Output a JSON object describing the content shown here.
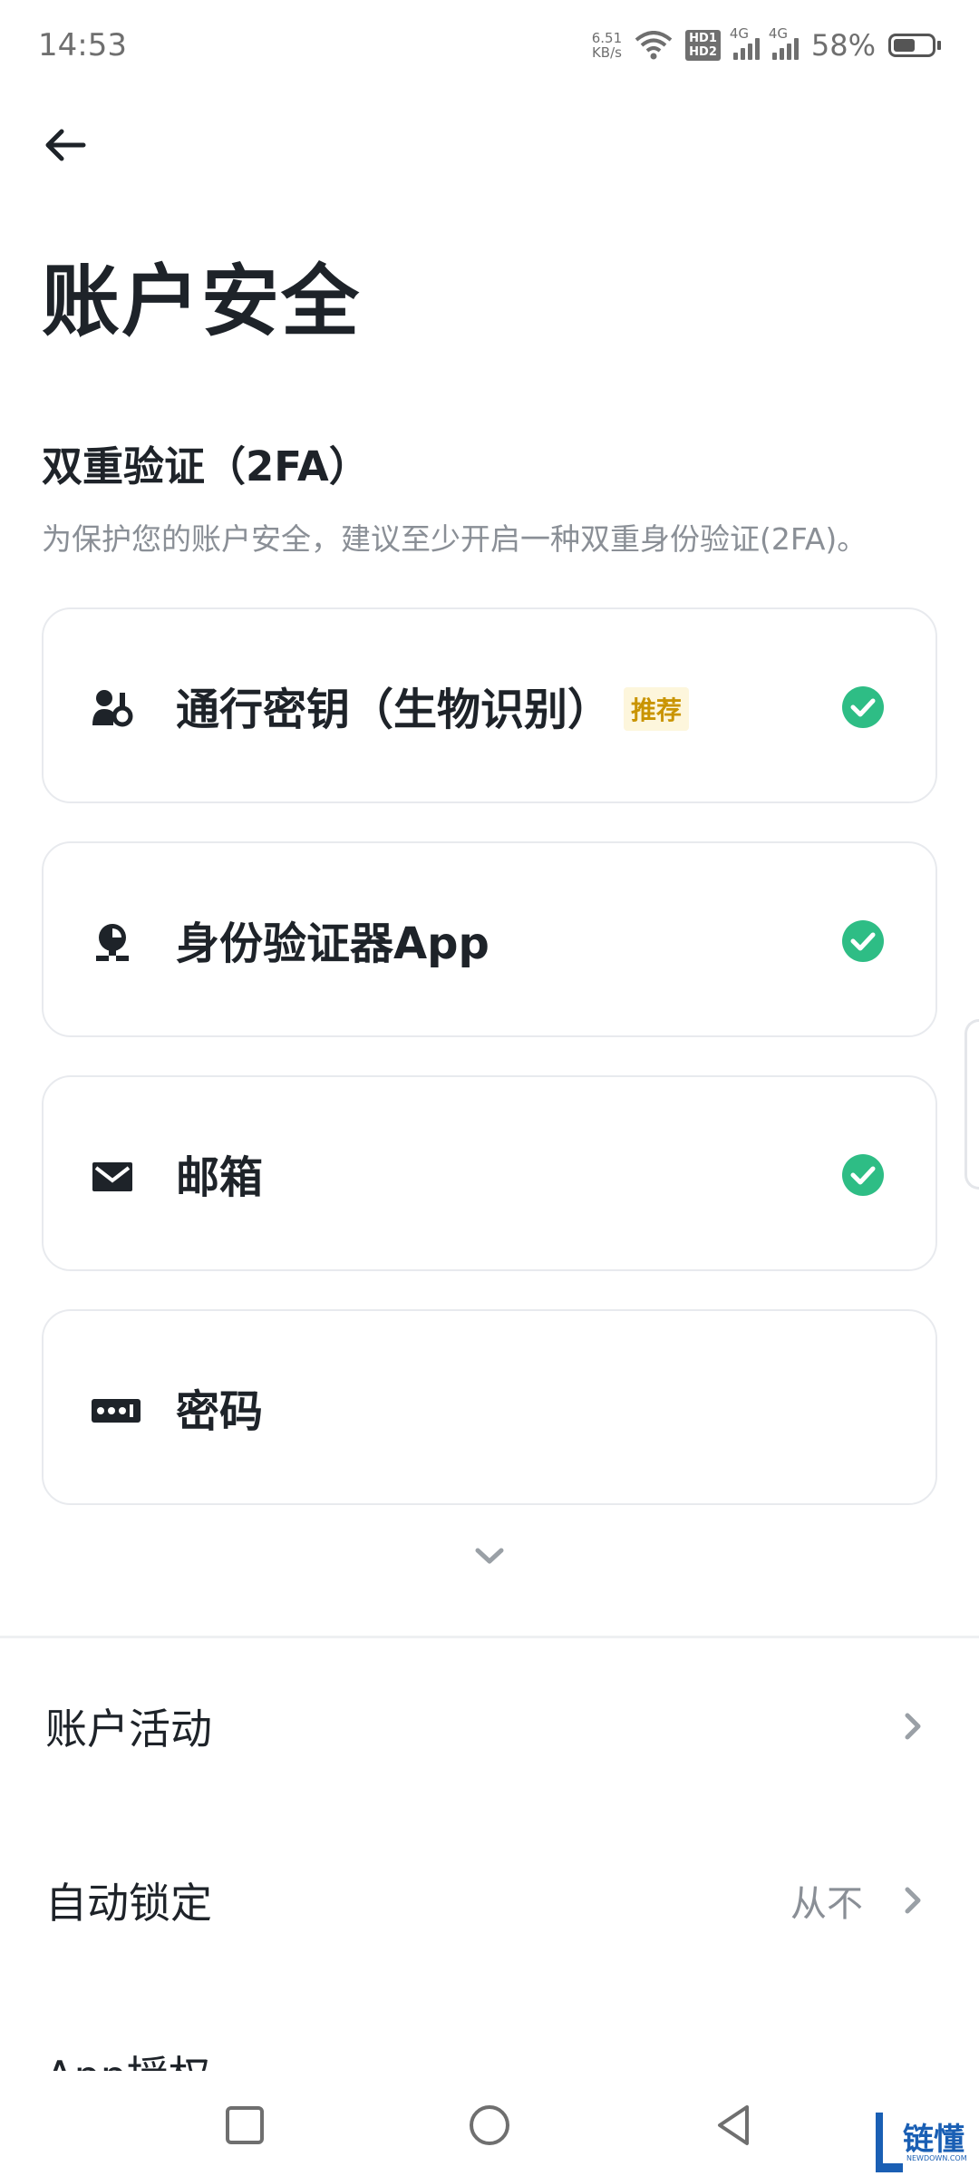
{
  "status_bar": {
    "time": "14:53",
    "net_speed_value": "6.51",
    "net_speed_unit": "KB/s",
    "hd1": "HD1",
    "hd2": "HD2",
    "network1": "4G",
    "network2": "4G",
    "battery_percent": "58%",
    "battery_level": 0.58
  },
  "header": {
    "back_icon": "arrow-left-icon",
    "title": "账户安全"
  },
  "two_factor": {
    "heading": "双重验证（2FA）",
    "description": "为保护您的账户安全，建议至少开启一种双重身份验证(2FA)。",
    "items": [
      {
        "label": "通行密钥（生物识别）",
        "badge": "推荐",
        "icon": "passkey-icon",
        "enabled": true
      },
      {
        "label": "身份验证器App",
        "icon": "authenticator-icon",
        "enabled": true
      },
      {
        "label": "邮箱",
        "icon": "email-icon",
        "enabled": true
      },
      {
        "label": "密码",
        "icon": "password-icon",
        "enabled": false
      }
    ],
    "check_color": "#2ebd85"
  },
  "settings": {
    "rows": [
      {
        "label": "账户活动",
        "value": ""
      },
      {
        "label": "自动锁定",
        "value": "从不"
      }
    ],
    "partial_row_label": "App授权"
  },
  "watermark": {
    "text": "链懂",
    "sub": "NEWDOWN.COM"
  },
  "colors": {
    "accent_green": "#2ebd85",
    "badge_bg": "#fdf6dc",
    "badge_text": "#c99400",
    "muted_text": "#8a8f96"
  }
}
